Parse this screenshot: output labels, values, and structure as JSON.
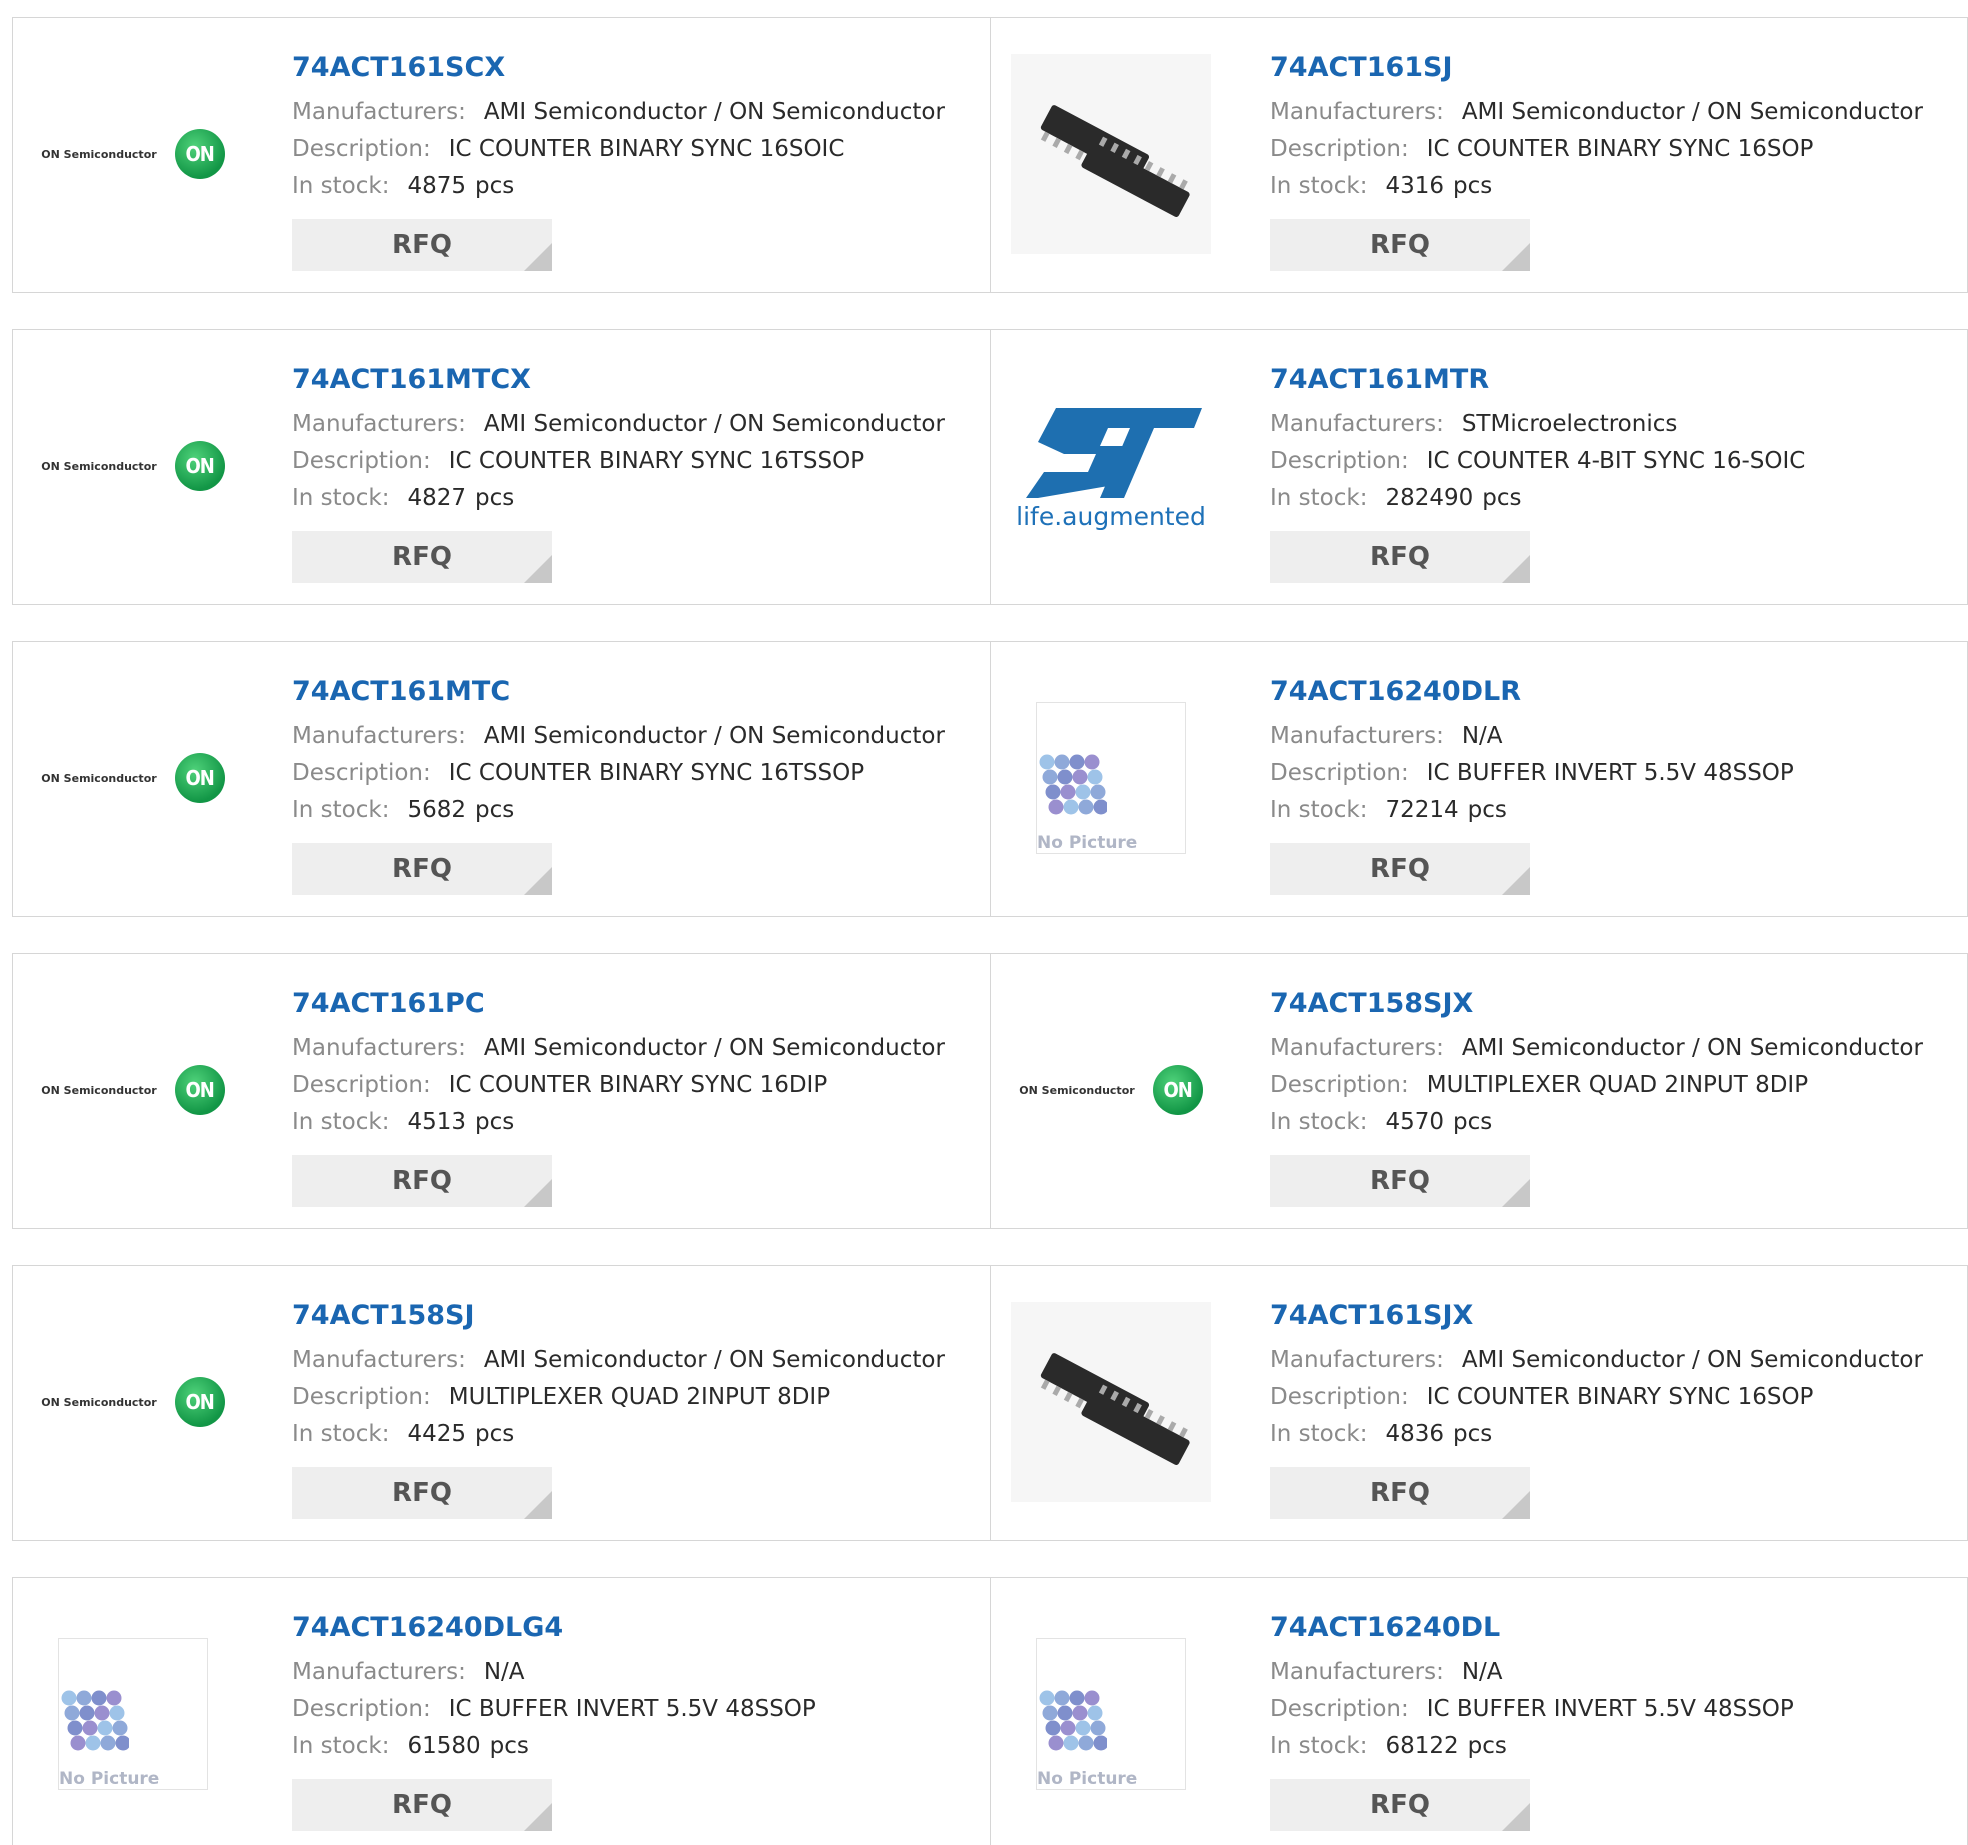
{
  "labels": {
    "manufacturers": "Manufacturers:",
    "description": "Description:",
    "in_stock": "In stock:",
    "rfq": "RFQ",
    "pcs": "pcs"
  },
  "logos": {
    "on_semi_text": "ON Semiconductor",
    "on_mark": "ON",
    "st_tagline": "life.augmented",
    "no_picture": "No Picture"
  },
  "colors": {
    "title": "#1a66b1",
    "label": "#8a8a8a",
    "rfq_bg": "#eeeeee",
    "border": "#d6d6d6",
    "on_green": "#129646",
    "st_blue": "#1e71b8"
  },
  "products": [
    {
      "part": "74ACT161SCX",
      "manufacturer": "AMI Semiconductor / ON Semiconductor",
      "description": "IC COUNTER BINARY SYNC 16SOIC",
      "stock": "4875",
      "image": "on-semi-logo"
    },
    {
      "part": "74ACT161SJ",
      "manufacturer": "AMI Semiconductor / ON Semiconductor",
      "description": "IC COUNTER BINARY SYNC 16SOP",
      "stock": "4316",
      "image": "ic-chip-photo"
    },
    {
      "part": "74ACT161MTCX",
      "manufacturer": "AMI Semiconductor / ON Semiconductor",
      "description": "IC COUNTER BINARY SYNC 16TSSOP",
      "stock": "4827",
      "image": "on-semi-logo"
    },
    {
      "part": "74ACT161MTR",
      "manufacturer": "STMicroelectronics",
      "description": "IC COUNTER 4-BIT SYNC 16-SOIC",
      "stock": "282490",
      "image": "st-logo"
    },
    {
      "part": "74ACT161MTC",
      "manufacturer": "AMI Semiconductor / ON Semiconductor",
      "description": "IC COUNTER BINARY SYNC 16TSSOP",
      "stock": "5682",
      "image": "on-semi-logo"
    },
    {
      "part": "74ACT16240DLR",
      "manufacturer": "N/A",
      "description": "IC BUFFER INVERT 5.5V 48SSOP",
      "stock": "72214",
      "image": "no-picture"
    },
    {
      "part": "74ACT161PC",
      "manufacturer": "AMI Semiconductor / ON Semiconductor",
      "description": "IC COUNTER BINARY SYNC 16DIP",
      "stock": "4513",
      "image": "on-semi-logo"
    },
    {
      "part": "74ACT158SJX",
      "manufacturer": "AMI Semiconductor / ON Semiconductor",
      "description": "MULTIPLEXER QUAD 2INPUT 8DIP",
      "stock": "4570",
      "image": "on-semi-logo"
    },
    {
      "part": "74ACT158SJ",
      "manufacturer": "AMI Semiconductor / ON Semiconductor",
      "description": "MULTIPLEXER QUAD 2INPUT 8DIP",
      "stock": "4425",
      "image": "on-semi-logo"
    },
    {
      "part": "74ACT161SJX",
      "manufacturer": "AMI Semiconductor / ON Semiconductor",
      "description": "IC COUNTER BINARY SYNC 16SOP",
      "stock": "4836",
      "image": "ic-chip-photo"
    },
    {
      "part": "74ACT16240DLG4",
      "manufacturer": "N/A",
      "description": "IC BUFFER INVERT 5.5V 48SSOP",
      "stock": "61580",
      "image": "no-picture"
    },
    {
      "part": "74ACT16240DL",
      "manufacturer": "N/A",
      "description": "IC BUFFER INVERT 5.5V 48SSOP",
      "stock": "68122",
      "image": "no-picture"
    }
  ]
}
